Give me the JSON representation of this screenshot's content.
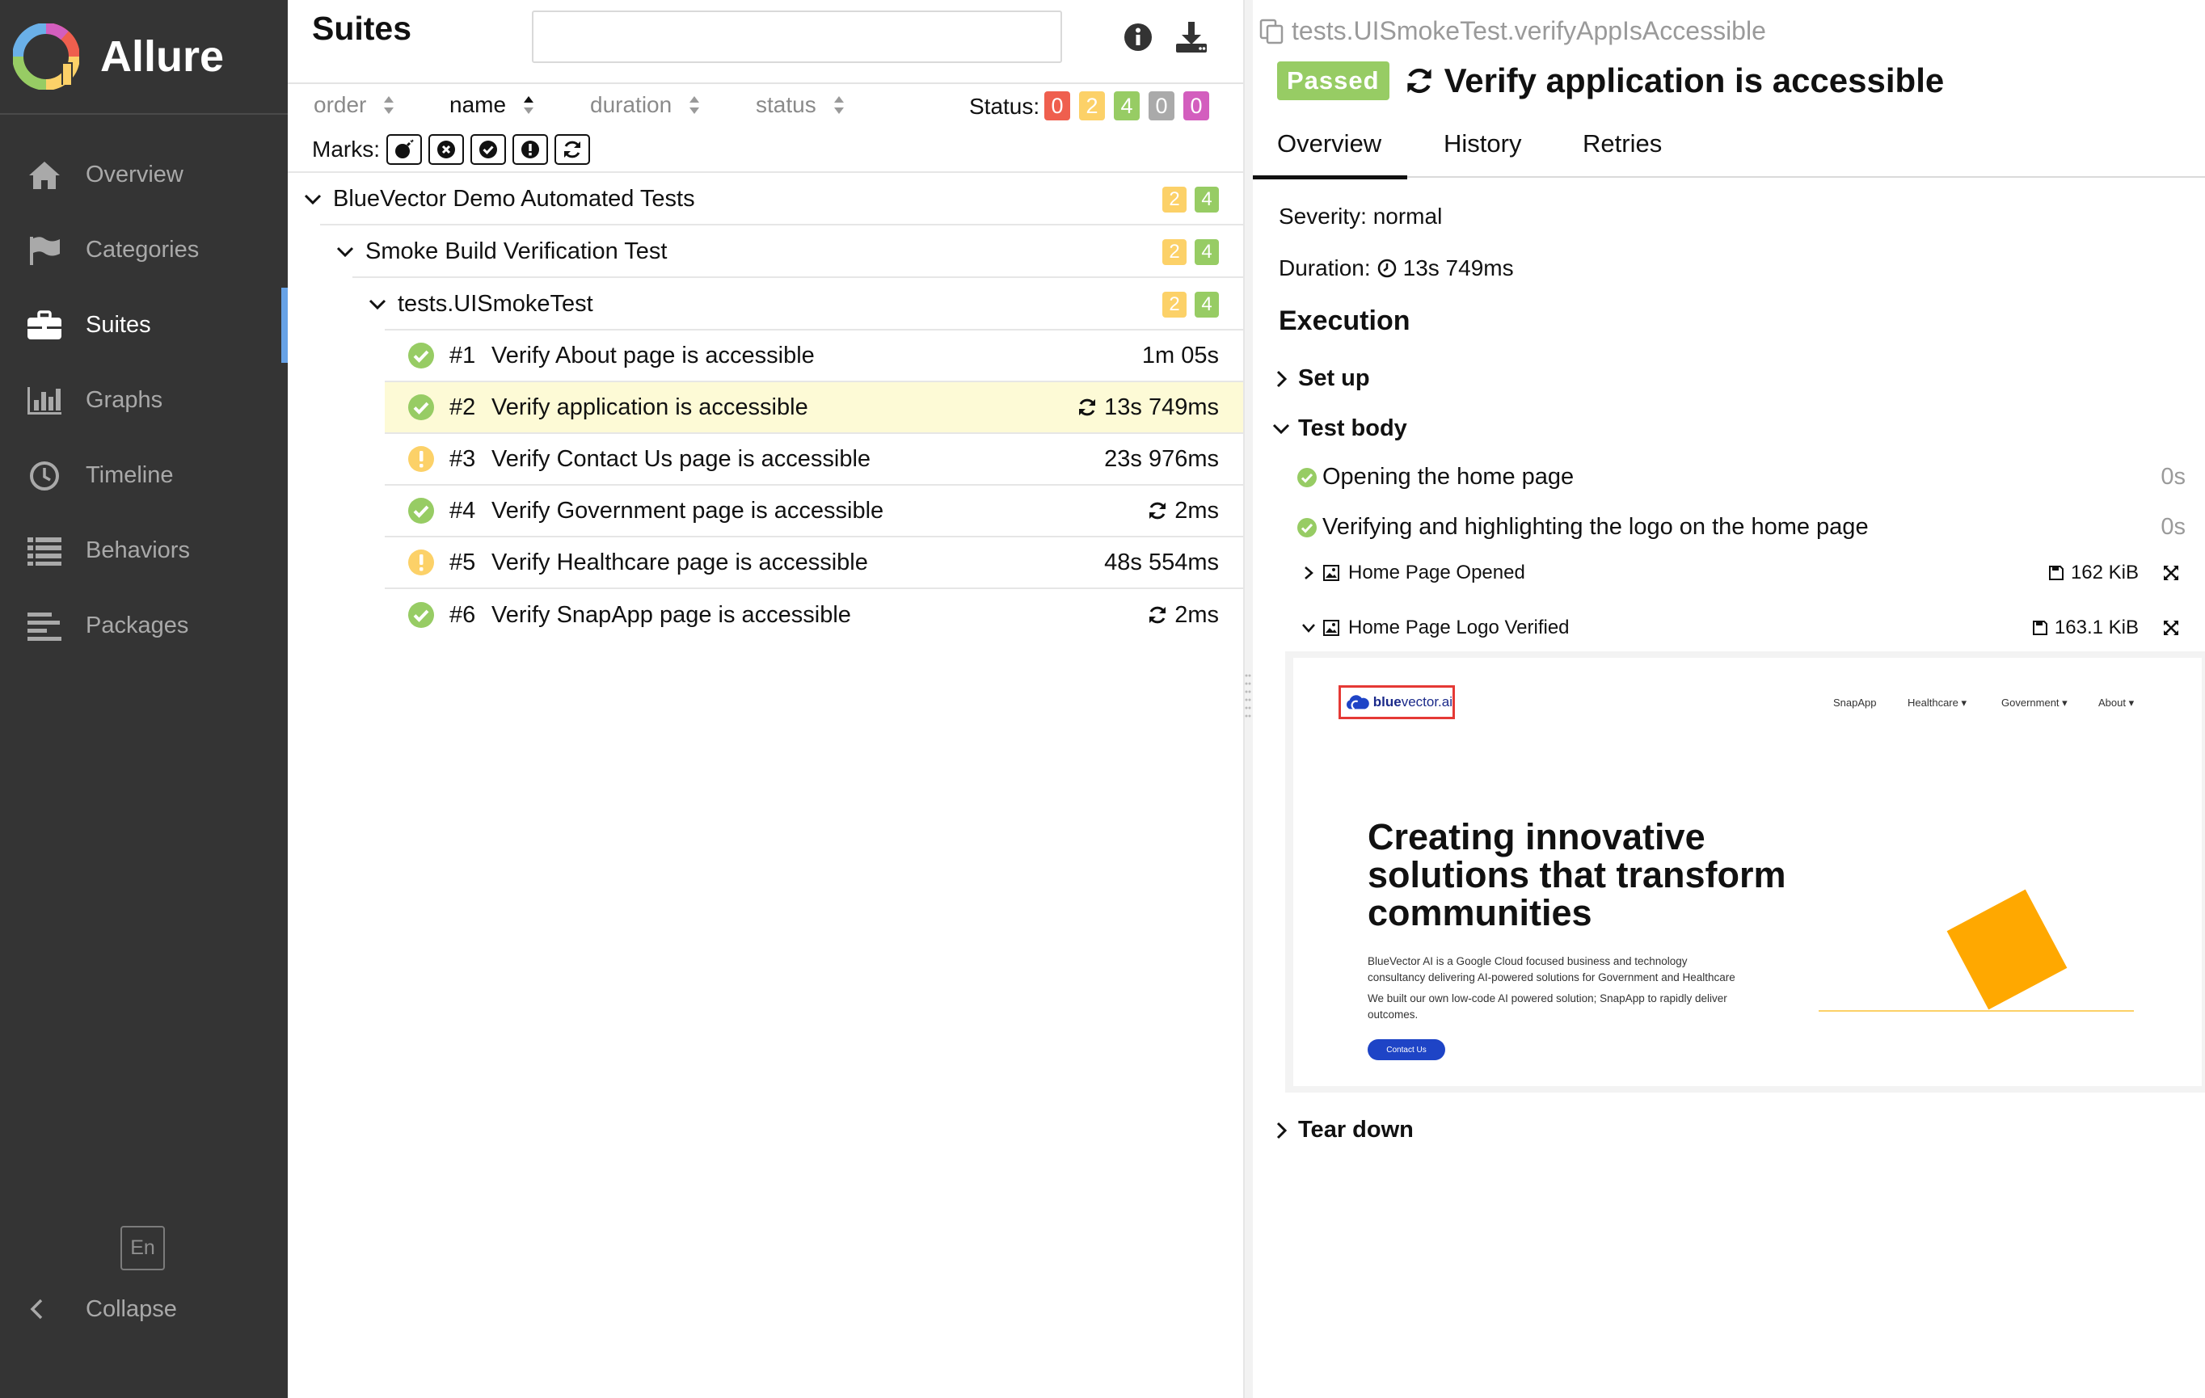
{
  "app": {
    "name": "Allure"
  },
  "sidebar": {
    "items": [
      {
        "label": "Overview",
        "icon": "home-icon"
      },
      {
        "label": "Categories",
        "icon": "flag-icon"
      },
      {
        "label": "Suites",
        "icon": "briefcase-icon",
        "active": true
      },
      {
        "label": "Graphs",
        "icon": "bar-chart-icon"
      },
      {
        "label": "Timeline",
        "icon": "clock-icon"
      },
      {
        "label": "Behaviors",
        "icon": "list-icon"
      },
      {
        "label": "Packages",
        "icon": "align-left-icon"
      }
    ],
    "language": "En",
    "collapse_label": "Collapse"
  },
  "suites": {
    "title": "Suites",
    "search_value": "",
    "sort": {
      "order": "order",
      "name": "name",
      "duration": "duration",
      "status": "status",
      "active": "name"
    },
    "status_label": "Status:",
    "status_counts": {
      "failed": "0",
      "broken": "2",
      "passed": "4",
      "skipped": "0",
      "unknown": "0"
    },
    "marks_label": "Marks:",
    "groups": [
      {
        "label": "BlueVector Demo Automated Tests",
        "broken": "2",
        "passed": "4"
      },
      {
        "label": "Smoke Build Verification Test",
        "broken": "2",
        "passed": "4"
      },
      {
        "label": "tests.UISmokeTest",
        "broken": "2",
        "passed": "4"
      }
    ],
    "tests": [
      {
        "num": "#1",
        "name": "Verify About page is accessible",
        "duration": "1m 05s",
        "status": "passed",
        "retried": false
      },
      {
        "num": "#2",
        "name": "Verify application is accessible",
        "duration": "13s 749ms",
        "status": "passed",
        "retried": true,
        "selected": true
      },
      {
        "num": "#3",
        "name": "Verify Contact Us page is accessible",
        "duration": "23s 976ms",
        "status": "broken",
        "retried": false
      },
      {
        "num": "#4",
        "name": "Verify Government page is accessible",
        "duration": "2ms",
        "status": "passed",
        "retried": true
      },
      {
        "num": "#5",
        "name": "Verify Healthcare page is accessible",
        "duration": "48s 554ms",
        "status": "broken",
        "retried": false
      },
      {
        "num": "#6",
        "name": "Verify SnapApp page is accessible",
        "duration": "2ms",
        "status": "passed",
        "retried": true
      }
    ]
  },
  "detail": {
    "full_name": "tests.UISmokeTest.verifyAppIsAccessible",
    "status_badge": "Passed",
    "title": "Verify application is accessible",
    "tabs": [
      "Overview",
      "History",
      "Retries"
    ],
    "severity": "Severity: normal",
    "duration_label": "Duration:",
    "duration_value": "13s 749ms",
    "execution_title": "Execution",
    "setup_label": "Set up",
    "test_body_label": "Test body",
    "steps": [
      {
        "label": "Opening the home page",
        "time": "0s"
      },
      {
        "label": "Verifying and highlighting the logo on the home page",
        "time": "0s"
      }
    ],
    "attachments": [
      {
        "label": "Home Page Opened",
        "size": "162 KiB"
      },
      {
        "label": "Home Page Logo Verified",
        "size": "163.1 KiB"
      }
    ],
    "teardown_label": "Tear down"
  },
  "screenshot": {
    "logo_bold": "blue",
    "logo_rest": "vector.ai",
    "nav": [
      "SnapApp",
      "Healthcare ▾",
      "Government ▾",
      "About ▾"
    ],
    "hero_lines": [
      "Creating innovative",
      "solutions that transform",
      "communities"
    ],
    "para1_line1": "BlueVector AI is a Google Cloud focused business and technology",
    "para1_line2": "consultancy delivering AI-powered solutions for Government and Healthcare",
    "para2_line1": "We built our own low-code AI powered solution; SnapApp to rapidly deliver",
    "para2_line2": "outcomes.",
    "button": "Contact Us"
  },
  "colors": {
    "sidebar_bg": "#343434",
    "active_indicator": "#67a2e6",
    "failed": "#ef5f4e",
    "broken": "#fcd168",
    "passed": "#97cc64",
    "skipped": "#aaaaaa",
    "unknown": "#d35ebe",
    "selected_row": "#fdfad6"
  }
}
